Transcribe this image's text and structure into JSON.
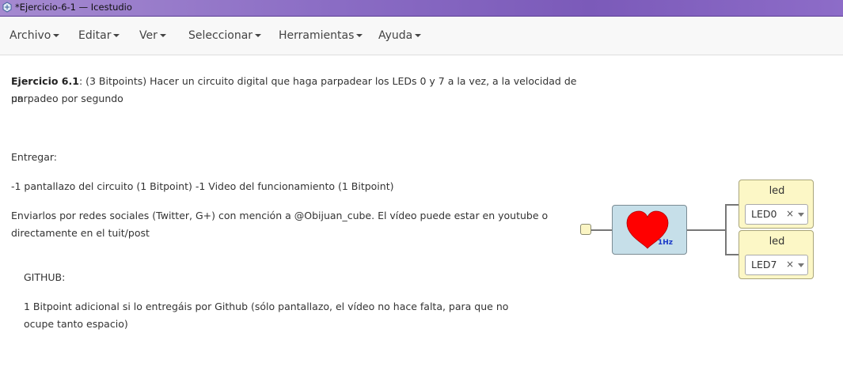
{
  "window": {
    "title": "*Ejercicio-6-1 — Icestudio",
    "icon": "icestudio-icon"
  },
  "menu": [
    {
      "label": "Archivo"
    },
    {
      "label": "Editar"
    },
    {
      "label": "Ver"
    },
    {
      "label": "Seleccionar"
    },
    {
      "label": "Herramientas"
    },
    {
      "label": "Ayuda"
    }
  ],
  "doc": {
    "heading": "Ejercicio 6.1",
    "intro_line1": ": (3 Bitpoints) Hacer un circuito digital que haga parpadear los LEDs 0 y 7 a la vez, a la velocidad de un",
    "intro_line2": "parpadeo por segundo",
    "deliver_label": "Entregar:",
    "deliver_items": "-1 pantallazo del circuito (1 Bitpoint) -1 Video del funcionamiento (1 Bitpoint)",
    "social_line1": "Enviarlos por redes sociales (Twitter, G+) con mención a @Obijuan_cube. El vídeo puede estar en youtube o",
    "social_line2": "directamente en el tuit/post",
    "github_label": "GITHUB:",
    "github_line1": "1 Bitpoint adicional si lo entregáis por Github (sólo pantallazo, el vídeo no hace falta, para que no",
    "github_line2": "ocupe tanto espacio)"
  },
  "circuit": {
    "clock_block": {
      "icon": "heart-icon",
      "freq_label": "1Hz",
      "color": "#c6dfe9",
      "heart_color": "#ff0000"
    },
    "led_blocks": [
      {
        "title": "led",
        "value": "LED0",
        "clear": "×"
      },
      {
        "title": "led",
        "value": "LED7",
        "clear": "×"
      }
    ]
  }
}
